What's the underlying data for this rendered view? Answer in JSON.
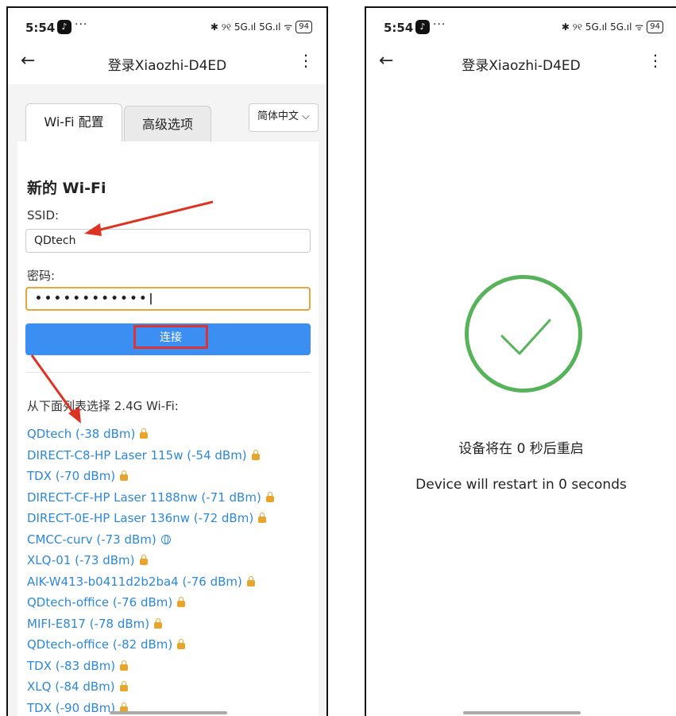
{
  "status": {
    "time": "5:54",
    "dots": "···",
    "signal": "✱ ୨୧ 5G.ıl 5G.ıl ᯤ",
    "battery": "94"
  },
  "nav": {
    "back": "←",
    "title": "登录Xiaozhi-D4ED",
    "menu": "⋮"
  },
  "tabs": {
    "wifi_config": "Wi-Fi 配置",
    "advanced": "高级选项"
  },
  "language": {
    "selected": "简体中文 ⌵"
  },
  "form": {
    "section_title": "新的 Wi-Fi",
    "ssid_label": "SSID:",
    "ssid_value": "QDtech",
    "password_label": "密码:",
    "password_value": "••••••••••••|",
    "connect": "连接"
  },
  "wifi": {
    "list_header": "从下面列表选择 2.4G Wi-Fi:",
    "networks": [
      {
        "name": "QDtech (-38 dBm)",
        "icon": "lock-icon"
      },
      {
        "name": "DIRECT-C8-HP Laser 115w (-54 dBm)",
        "icon": "lock-icon"
      },
      {
        "name": "TDX (-70 dBm)",
        "icon": "lock-icon"
      },
      {
        "name": "DIRECT-CF-HP Laser 1188nw (-71 dBm)",
        "icon": "lock-icon"
      },
      {
        "name": "DIRECT-0E-HP Laser 136nw (-72 dBm)",
        "icon": "lock-icon"
      },
      {
        "name": "CMCC-curv (-73 dBm)",
        "icon": "globe-icon"
      },
      {
        "name": "XLQ-01 (-73 dBm)",
        "icon": "lock-icon"
      },
      {
        "name": "AIK-W413-b0411d2b2ba4 (-76 dBm)",
        "icon": "lock-icon"
      },
      {
        "name": "QDtech-office (-76 dBm)",
        "icon": "lock-icon"
      },
      {
        "name": "MIFI-E817 (-78 dBm)",
        "icon": "lock-icon"
      },
      {
        "name": "QDtech-office (-82 dBm)",
        "icon": "lock-icon"
      },
      {
        "name": "TDX (-83 dBm)",
        "icon": "lock-icon"
      },
      {
        "name": "XLQ (-84 dBm)",
        "icon": "lock-icon"
      },
      {
        "name": "TDX (-90 dBm)",
        "icon": "lock-icon"
      }
    ]
  },
  "restart": {
    "message_cn": "设备将在 0 秒后重启",
    "message_en": "Device will restart in 0 seconds"
  },
  "colors": {
    "accent_blue": "#3b8ff2",
    "link_blue": "#2d88d8",
    "success_green": "#56b35a",
    "annotation_red": "#dd3322",
    "lock_orange": "#e8a42b"
  }
}
